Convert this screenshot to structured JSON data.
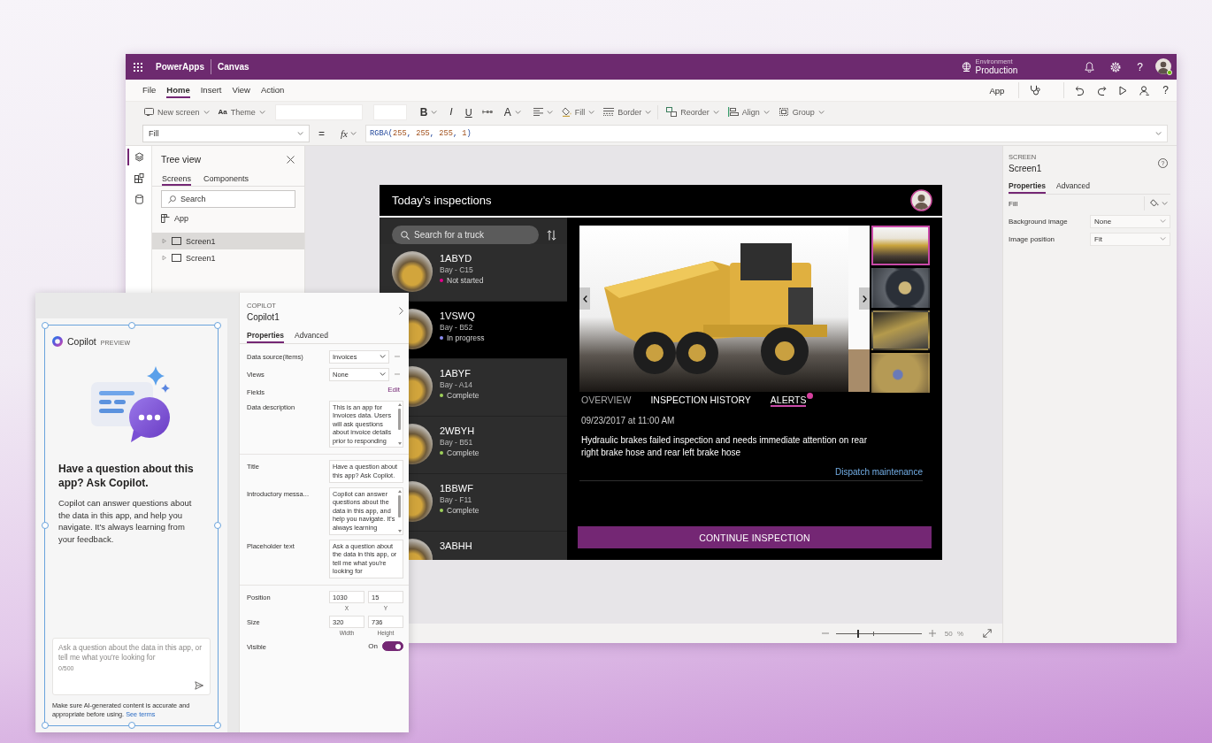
{
  "top_bar": {
    "product": "PowerApps",
    "mode": "Canvas",
    "environment_label": "Environment",
    "environment": "Production",
    "help": "?"
  },
  "menu": [
    {
      "label": "File",
      "selected": false
    },
    {
      "label": "Home",
      "selected": true
    },
    {
      "label": "Insert",
      "selected": false
    },
    {
      "label": "View",
      "selected": false
    },
    {
      "label": "Action",
      "selected": false
    }
  ],
  "command_bar": {
    "app_label": "App",
    "help": "?"
  },
  "ribbon": {
    "new_screen": "New screen",
    "theme_glyph": "Aa",
    "theme": "Theme",
    "bold": "B",
    "italic": "I",
    "underline": "U",
    "font_color": "A",
    "fill": "Fill",
    "border": "Border",
    "reorder": "Reorder",
    "align": "Align",
    "group": "Group"
  },
  "formula_bar": {
    "property": "Fill",
    "equals": "=",
    "fx": "fx",
    "formula": "RGBA(255, 255, 255, 1)"
  },
  "left_rail": [
    {
      "selected": true
    },
    {
      "selected": false
    },
    {
      "selected": false
    }
  ],
  "tree_view": {
    "title": "Tree view",
    "tabs": [
      {
        "label": "Screens",
        "selected": true
      },
      {
        "label": "Components",
        "selected": false
      }
    ],
    "search_placeholder": "Search",
    "app_item": "App",
    "screens": [
      {
        "label": "Screen1",
        "selected": true,
        "expanded": false
      },
      {
        "label": "Screen1",
        "selected": false,
        "expanded": false
      }
    ]
  },
  "app_preview": {
    "title": "Today’s inspections",
    "search_placeholder": "Search for a truck",
    "trucks": [
      {
        "id": "1ABYD",
        "bay": "Bay - C15",
        "status": "Not started",
        "color": "#e3008c",
        "selected": false
      },
      {
        "id": "1VSWQ",
        "bay": "Bay - B52",
        "status": "In progress",
        "color": "#8b8cf0",
        "selected": true
      },
      {
        "id": "1ABYF",
        "bay": "Bay - A14",
        "status": "Complete",
        "color": "#9fd15a",
        "selected": false
      },
      {
        "id": "2WBYH",
        "bay": "Bay - B51",
        "status": "Complete",
        "color": "#9fd15a",
        "selected": false
      },
      {
        "id": "1BBWF",
        "bay": "Bay - F11",
        "status": "Complete",
        "color": "#9fd15a",
        "selected": false
      },
      {
        "id": "3ABHH",
        "selected": false
      }
    ],
    "thumbnails": [
      {
        "selected": true
      },
      {
        "selected": false
      },
      {
        "selected": false
      },
      {
        "selected": false
      }
    ],
    "tabs": [
      {
        "label": "OVERVIEW",
        "selected": false,
        "disabled": true,
        "badge": false
      },
      {
        "label": "INSPECTION HISTORY",
        "selected": false,
        "disabled": false,
        "badge": false
      },
      {
        "label": "ALERTS",
        "selected": true,
        "disabled": false,
        "badge": true
      }
    ],
    "date": "09/23/2017 at 11:00 AM",
    "description": "Hydraulic brakes failed inspection and needs immediate attention on rear right brake hose and rear left brake hose",
    "link": "Dispatch maintenance",
    "button": "CONTINUE INSPECTION"
  },
  "zoom": {
    "level": 0.26,
    "text": "50 %"
  },
  "properties_panel": {
    "kind_label": "SCREEN",
    "name": "Screen1",
    "help": "?",
    "tabs": [
      {
        "label": "Properties",
        "selected": true
      },
      {
        "label": "Advanced",
        "selected": false
      }
    ],
    "rows": [
      {
        "kind": "color",
        "label": "Fill"
      },
      {
        "kind": "dropdown",
        "label": "Background image",
        "value": "None"
      },
      {
        "kind": "dropdown",
        "label": "Image position",
        "value": "Fit"
      }
    ]
  },
  "copilot_panel": {
    "preview": {
      "name": "Copilot",
      "badge": "PREVIEW",
      "heading": "Have a question about this app? Ask Copilot.",
      "intro": "Copilot can answer questions about the data in this app, and help you navigate. It's always learning from your feedback.",
      "input_placeholder": "Ask a question about the data in this app, or tell me what you're looking for",
      "counter": "0/500",
      "disclaimer": "Make sure AI-generated content is accurate and appropriate before using.",
      "terms_link": "See terms"
    },
    "properties": {
      "kind_label": "COPILOT",
      "name": "Copilot1",
      "tabs": [
        {
          "label": "Properties",
          "selected": true
        },
        {
          "label": "Advanced",
          "selected": false
        }
      ],
      "sections": [
        {
          "rows": [
            {
              "kind": "dropdown",
              "label": "Data source(Items)",
              "value": "Invoices"
            },
            {
              "kind": "dropdown",
              "label": "Views",
              "value": "None"
            },
            {
              "kind": "link",
              "label": "Fields",
              "value": "Edit"
            },
            {
              "kind": "textarea",
              "label": "Data description",
              "value": "This is an app for Invoices data. Users will ask questions about invoice details prior to responding",
              "scrollable": true
            }
          ]
        },
        {
          "rows": [
            {
              "kind": "textarea",
              "label": "Title",
              "value": "Have a question about this app? Ask Copilot.",
              "scrollable": false
            },
            {
              "kind": "textarea",
              "label": "Introductory messa...",
              "value": "Copilot can answer questions about the data in this app, and help you navigate. It's always learning",
              "scrollable": true
            },
            {
              "kind": "textarea",
              "label": "Placeholder text",
              "value": "Ask a question about the data in this app, or tell me what you're looking for",
              "scrollable": false
            }
          ]
        },
        {
          "rows": [
            {
              "kind": "pair",
              "label": "Position",
              "fields": [
                {
                  "value": "1030",
                  "caption": "X"
                },
                {
                  "value": "15",
                  "caption": "Y"
                }
              ]
            },
            {
              "kind": "pair",
              "label": "Size",
              "fields": [
                {
                  "value": "320",
                  "caption": "Width"
                },
                {
                  "value": "736",
                  "caption": "Height"
                }
              ]
            },
            {
              "kind": "toggle",
              "label": "Visible",
              "value": "On",
              "on": true
            }
          ]
        }
      ]
    }
  }
}
